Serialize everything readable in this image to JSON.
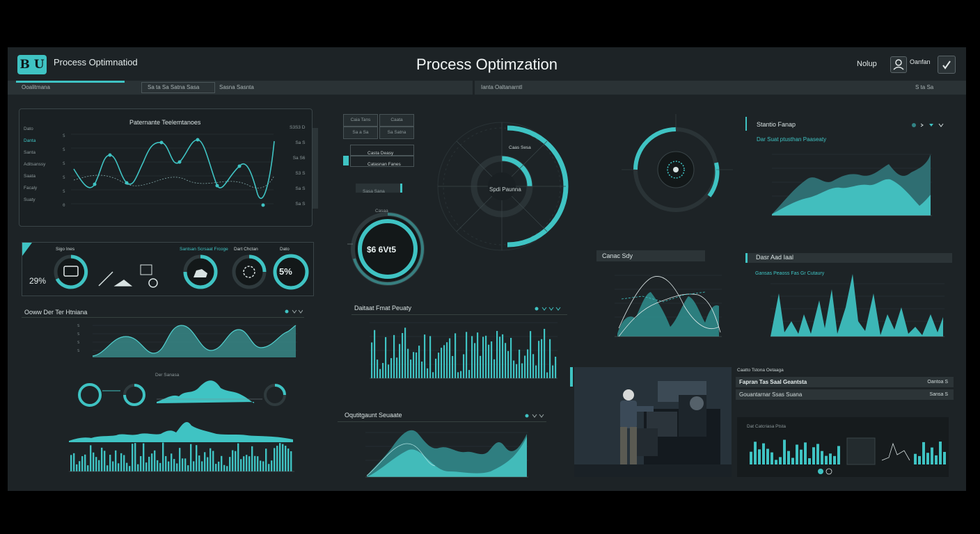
{
  "header": {
    "logo_text": "B U",
    "app_title": "Process Optimnatiod",
    "page_title": "Process Optimzation",
    "user_label": "Nolup",
    "account_label": "Oanfan"
  },
  "tabs": {
    "left": "Ooalitmana",
    "mid1": "Sa ta Sa Satna Sasa",
    "mid2": "Sasna Sasnta",
    "right": "Ianta Oaltanarntl",
    "right_icons": "S  ta  Sa"
  },
  "line_panel": {
    "title": "Paternante Teelemtanoes",
    "legend": [
      "Dato",
      "Danta",
      "Santa",
      "Aditsanssy",
      "Saata",
      "Facaly",
      "Suaty"
    ],
    "right_labels": [
      "S3S3 D",
      "Sa S",
      "Sa S6",
      "S3 S",
      "Sa S",
      "Sa S"
    ],
    "y_ticks": [
      "S",
      "S",
      "S",
      "S",
      "S",
      "S",
      "S",
      "S",
      "0"
    ]
  },
  "kpi_row": {
    "labels": [
      "Sigo Ines",
      "Santsan Scrsaat Frcoge",
      "Dart Chctan",
      "Dato"
    ],
    "left_pct": "29%",
    "right_pct": "5%"
  },
  "wave_panel": {
    "title": "Ooww Der Ter Htniana"
  },
  "small_bands": {
    "title": "Der Sanasa"
  },
  "center": {
    "btns": [
      "Caia Tans",
      "Caata",
      "Sa a Sa",
      "Sa Satna"
    ],
    "list": [
      "Casta Deasy",
      "Catasnan Fanes"
    ],
    "mini_label": "Sasa Sana",
    "donut_value": "$6 6Vt5",
    "donut_top": "Casaa",
    "ring_label": "Spdi Paunna",
    "ring_inner": "Caas Sesa"
  },
  "mid_bars": {
    "title": "Daitaat Fmat Peuaty"
  },
  "mid_area": {
    "title": "Oqutitgaunt Seuaate"
  },
  "right_gauge": {
    "title": "Gauge"
  },
  "right_top": {
    "title": "Stantio Fanap",
    "subtitle": "Dar Suat ptusthan Paaseaty"
  },
  "right_mid": {
    "title": "Dasr Aad Iaal",
    "subtitle": "Gansas Peaoss Fas Gr Cutaury"
  },
  "mini_chart": {
    "title": "Canac Sdy"
  },
  "photo": {
    "alt": "Worker at industrial machine"
  },
  "right_info": {
    "caption": "Caatto Tstona Oetaaga",
    "row1": "Fapran Tas Saal Geantsta",
    "row1_val": "Oantoa S",
    "row2": "Gouantarnar Ssas Suana",
    "row2_val": "Sansa S"
  },
  "mini_bars": {
    "title": "Dat Catcriasa Ptsta"
  },
  "colors": {
    "accent": "#3fc3c3",
    "bg": "#1d2326",
    "panel": "#1a2023"
  }
}
